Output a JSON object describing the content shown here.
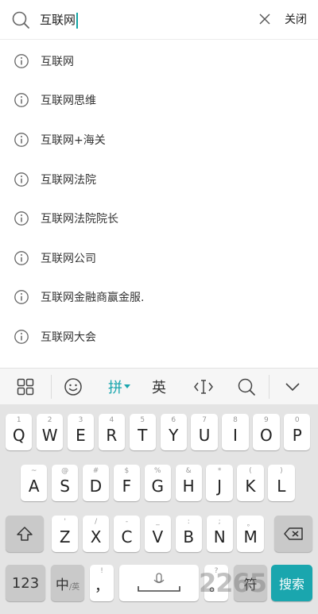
{
  "search": {
    "query": "互联网",
    "close_label": "关闭"
  },
  "suggestions": [
    "互联网",
    "互联网思维",
    "互联网+海关",
    "互联网法院",
    "互联网法院院长",
    "互联网公司",
    "互联网金融商赢金服.",
    "互联网大会"
  ],
  "ime_toolbar": {
    "pinyin_label": "拼",
    "english_label": "英"
  },
  "keyboard": {
    "row1": [
      {
        "key": "Q",
        "sub": "1"
      },
      {
        "key": "W",
        "sub": "2"
      },
      {
        "key": "E",
        "sub": "3"
      },
      {
        "key": "R",
        "sub": "4"
      },
      {
        "key": "T",
        "sub": "5"
      },
      {
        "key": "Y",
        "sub": "6"
      },
      {
        "key": "U",
        "sub": "7"
      },
      {
        "key": "I",
        "sub": "8"
      },
      {
        "key": "O",
        "sub": "9"
      },
      {
        "key": "P",
        "sub": "0"
      }
    ],
    "row2": [
      {
        "key": "A",
        "sub": "~"
      },
      {
        "key": "S",
        "sub": "@"
      },
      {
        "key": "D",
        "sub": "#"
      },
      {
        "key": "F",
        "sub": "$"
      },
      {
        "key": "G",
        "sub": "%"
      },
      {
        "key": "H",
        "sub": "&"
      },
      {
        "key": "J",
        "sub": "*"
      },
      {
        "key": "K",
        "sub": "("
      },
      {
        "key": "L",
        "sub": ")"
      }
    ],
    "row3": [
      {
        "key": "Z",
        "sub": "'"
      },
      {
        "key": "X",
        "sub": "/"
      },
      {
        "key": "C",
        "sub": "-"
      },
      {
        "key": "V",
        "sub": "_"
      },
      {
        "key": "B",
        "sub": ":"
      },
      {
        "key": "N",
        "sub": ";"
      },
      {
        "key": "M",
        "sub": "。"
      }
    ],
    "num_label": "123",
    "lang_main": "中",
    "lang_sub": "/英",
    "comma_label": "，",
    "comma_sub": "!",
    "period_sub": "?",
    "symbol_label": "符",
    "search_label": "搜索",
    "accent_color": "#1aa6ae"
  },
  "watermark": "2265"
}
